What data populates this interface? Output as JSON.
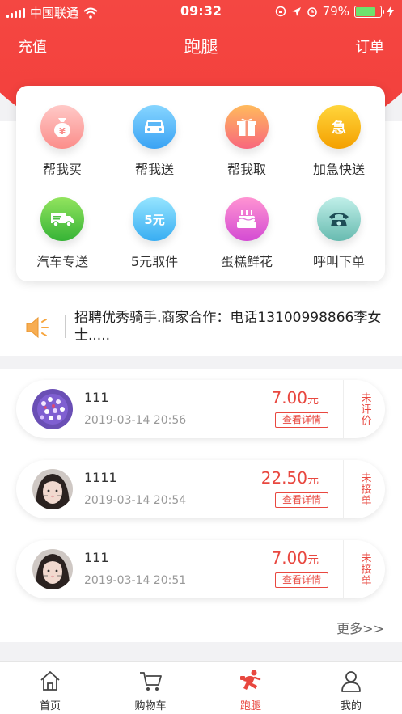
{
  "status_bar": {
    "carrier": "中国联通",
    "time": "09:32",
    "battery": "79%"
  },
  "nav": {
    "left": "充值",
    "title": "跑腿",
    "right": "订单"
  },
  "services": [
    {
      "label": "帮我买",
      "icon": "money-bag-icon",
      "glyph": "¥",
      "color_top": "#ffc3c1",
      "color_bottom": "#fb8f8c"
    },
    {
      "label": "帮我送",
      "icon": "car-icon",
      "glyph": "",
      "color_top": "#7fd0ff",
      "color_bottom": "#3fa6f5"
    },
    {
      "label": "帮我取",
      "icon": "gift-icon",
      "glyph": "",
      "color_top": "#ffb65e",
      "color_bottom": "#f96c7a"
    },
    {
      "label": "加急快送",
      "icon": "urgent-icon",
      "glyph": "急",
      "color_top": "#ffd23a",
      "color_bottom": "#f5a300"
    },
    {
      "label": "汽车专送",
      "icon": "truck-icon",
      "glyph": "",
      "color_top": "#8be05a",
      "color_bottom": "#3cb83a"
    },
    {
      "label": "5元取件",
      "icon": "five-yuan-icon",
      "glyph": "5元",
      "color_top": "#8fe2ff",
      "color_bottom": "#3fb2f3"
    },
    {
      "label": "蛋糕鲜花",
      "icon": "cake-icon",
      "glyph": "",
      "color_top": "#ff8fd0",
      "color_bottom": "#d94fd4"
    },
    {
      "label": "呼叫下单",
      "icon": "telephone-icon",
      "glyph": "",
      "color_top": "#b8ede6",
      "color_bottom": "#6dbfb3"
    }
  ],
  "notice": {
    "icon": "speaker-icon",
    "text": "招聘优秀骑手.商家合作：电话13100998866李女士....."
  },
  "orders": [
    {
      "name": "111",
      "time": "2019-03-14 20:56",
      "price": "7.00",
      "unit": "元",
      "detail_label": "查看详情",
      "status": "未评价"
    },
    {
      "name": "1111",
      "time": "2019-03-14 20:54",
      "price": "22.50",
      "unit": "元",
      "detail_label": "查看详情",
      "status": "未接单"
    },
    {
      "name": "111",
      "time": "2019-03-14 20:51",
      "price": "7.00",
      "unit": "元",
      "detail_label": "查看详情",
      "status": "未接单"
    }
  ],
  "more_label": "更多>>",
  "tabs": [
    {
      "label": "首页",
      "icon": "home-icon"
    },
    {
      "label": "购物车",
      "icon": "cart-icon"
    },
    {
      "label": "跑腿",
      "icon": "runner-icon",
      "active": true
    },
    {
      "label": "我的",
      "icon": "user-icon"
    }
  ],
  "colors": {
    "brand_red": "#f23d3a",
    "accent": "#e8473f"
  }
}
